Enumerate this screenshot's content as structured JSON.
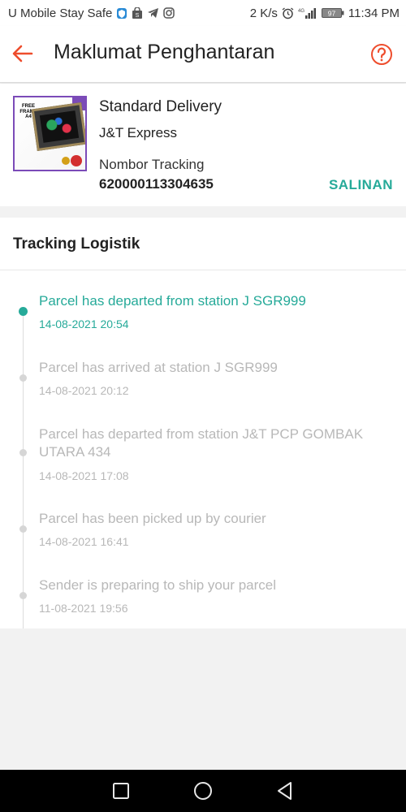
{
  "status_bar": {
    "carrier": "U Mobile Stay Safe",
    "speed": "2 K/s",
    "network": "4G",
    "battery": "97",
    "time": "11:34 PM",
    "icons": [
      "shield-icon",
      "shopping-bag-icon",
      "telegram-icon",
      "instagram-icon",
      "alarm-icon",
      "signal-icon",
      "battery-icon"
    ]
  },
  "header": {
    "title": "Maklumat Penghantaran",
    "back_icon": "arrow-left-icon",
    "help_icon": "help-circle-icon"
  },
  "delivery": {
    "service": "Standard Delivery",
    "courier": "J&T Express",
    "tracking_label": "Nombor Tracking",
    "tracking_number": "620000113304635",
    "copy_label": "SALINAN",
    "thumb_text": "FREE FRAME A4"
  },
  "tracking": {
    "title": "Tracking Logistik",
    "events": [
      {
        "text": "Parcel has departed from station J SGR999",
        "time": "14-08-2021 20:54",
        "active": true
      },
      {
        "text": "Parcel has arrived at station J SGR999",
        "time": "14-08-2021 20:12",
        "active": false
      },
      {
        "text": "Parcel has departed from station J&T PCP GOMBAK UTARA 434",
        "time": "14-08-2021 17:08",
        "active": false
      },
      {
        "text": "Parcel has been picked up by courier",
        "time": "14-08-2021 16:41",
        "active": false
      },
      {
        "text": "Sender is preparing to ship your parcel",
        "time": "11-08-2021 19:56",
        "active": false
      }
    ]
  },
  "colors": {
    "accent_orange": "#ee4d2d",
    "accent_teal": "#26aa99",
    "muted_text": "#b8b8b8"
  },
  "nav": {
    "icons": [
      "recent-apps-icon",
      "home-icon",
      "back-icon"
    ]
  }
}
